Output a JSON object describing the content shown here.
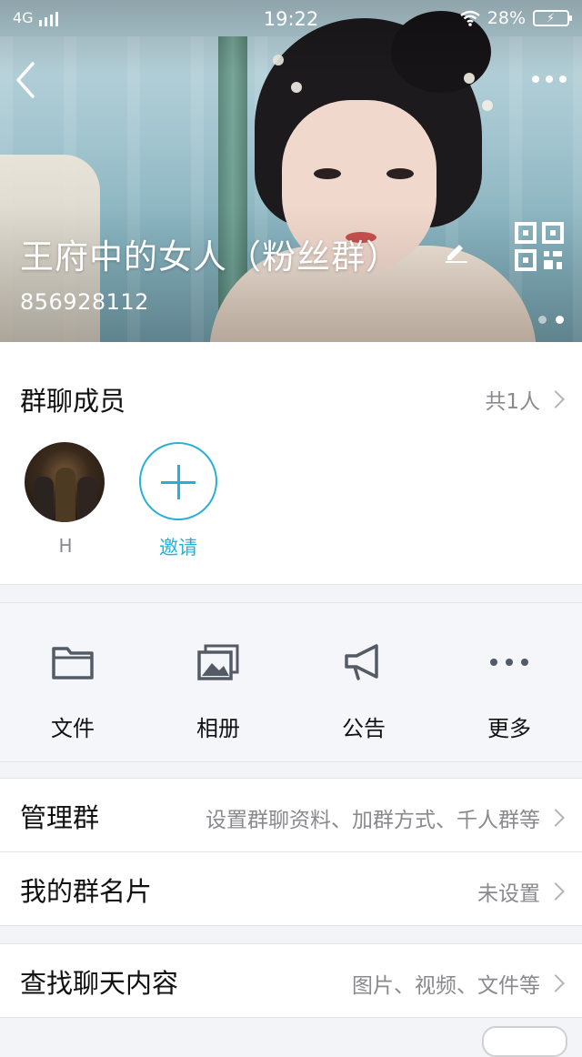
{
  "status_bar": {
    "network": "4G",
    "time": "19:22",
    "battery": "28%"
  },
  "header": {
    "group_name": "王府中的女人（粉丝群）",
    "group_id": "856928112"
  },
  "members": {
    "title": "群聊成员",
    "count": "共1人",
    "list": [
      {
        "name": "H"
      }
    ],
    "invite_label": "邀请"
  },
  "features": [
    {
      "label": "文件",
      "icon": "folder-icon"
    },
    {
      "label": "相册",
      "icon": "photo-album-icon"
    },
    {
      "label": "公告",
      "icon": "megaphone-icon"
    },
    {
      "label": "更多",
      "icon": "more-dots-icon"
    }
  ],
  "rows": {
    "manage": {
      "title": "管理群",
      "value": "设置群聊资料、加群方式、千人群等"
    },
    "card": {
      "title": "我的群名片",
      "value": "未设置"
    },
    "search": {
      "title": "查找聊天内容",
      "value": "图片、视频、文件等"
    }
  },
  "colors": {
    "accent": "#27b0d6",
    "secondary_text": "#8a8a8e",
    "page_bg": "#f3f4f7"
  }
}
